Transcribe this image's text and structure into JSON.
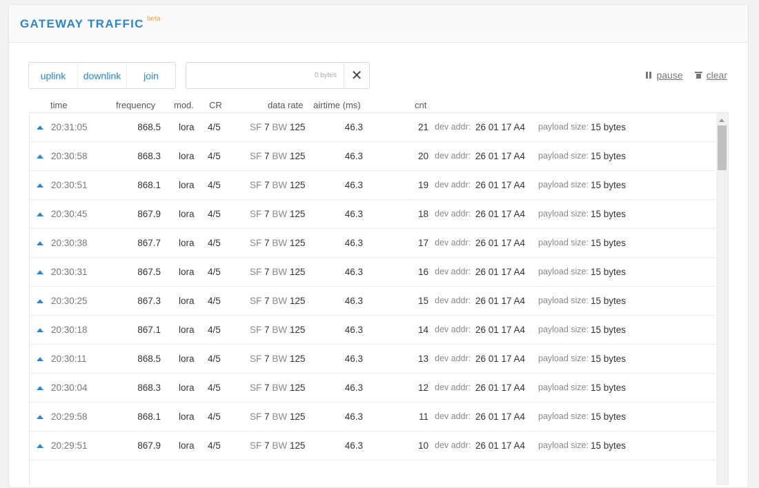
{
  "header": {
    "title": "GATEWAY TRAFFIC",
    "badge": "beta"
  },
  "toolbar": {
    "filters": [
      "uplink",
      "downlink",
      "join"
    ],
    "size_filter": {
      "value": "",
      "placeholder": "",
      "unit": "0 bytes"
    },
    "clear_filter_icon": "close-icon",
    "pause_label": "pause",
    "clear_label": "clear"
  },
  "columns": {
    "time": "time",
    "frequency": "frequency",
    "mod": "mod.",
    "cr": "CR",
    "data_rate": "data rate",
    "airtime": "airtime (ms)",
    "cnt": "cnt"
  },
  "labels": {
    "sf": "SF",
    "bw": "BW",
    "dev_addr": "dev addr:",
    "payload_size": "payload size:"
  },
  "accent_color": "#2a85d0",
  "rows": [
    {
      "time": "20:31:05",
      "frequency": "868.5",
      "mod": "lora",
      "cr": "4/5",
      "sf": "7",
      "bw": "125",
      "airtime": "46.3",
      "cnt": "21",
      "dev_addr": "26 01 17 A4",
      "payload": "15 bytes"
    },
    {
      "time": "20:30:58",
      "frequency": "868.3",
      "mod": "lora",
      "cr": "4/5",
      "sf": "7",
      "bw": "125",
      "airtime": "46.3",
      "cnt": "20",
      "dev_addr": "26 01 17 A4",
      "payload": "15 bytes"
    },
    {
      "time": "20:30:51",
      "frequency": "868.1",
      "mod": "lora",
      "cr": "4/5",
      "sf": "7",
      "bw": "125",
      "airtime": "46.3",
      "cnt": "19",
      "dev_addr": "26 01 17 A4",
      "payload": "15 bytes"
    },
    {
      "time": "20:30:45",
      "frequency": "867.9",
      "mod": "lora",
      "cr": "4/5",
      "sf": "7",
      "bw": "125",
      "airtime": "46.3",
      "cnt": "18",
      "dev_addr": "26 01 17 A4",
      "payload": "15 bytes"
    },
    {
      "time": "20:30:38",
      "frequency": "867.7",
      "mod": "lora",
      "cr": "4/5",
      "sf": "7",
      "bw": "125",
      "airtime": "46.3",
      "cnt": "17",
      "dev_addr": "26 01 17 A4",
      "payload": "15 bytes"
    },
    {
      "time": "20:30:31",
      "frequency": "867.5",
      "mod": "lora",
      "cr": "4/5",
      "sf": "7",
      "bw": "125",
      "airtime": "46.3",
      "cnt": "16",
      "dev_addr": "26 01 17 A4",
      "payload": "15 bytes"
    },
    {
      "time": "20:30:25",
      "frequency": "867.3",
      "mod": "lora",
      "cr": "4/5",
      "sf": "7",
      "bw": "125",
      "airtime": "46.3",
      "cnt": "15",
      "dev_addr": "26 01 17 A4",
      "payload": "15 bytes"
    },
    {
      "time": "20:30:18",
      "frequency": "867.1",
      "mod": "lora",
      "cr": "4/5",
      "sf": "7",
      "bw": "125",
      "airtime": "46.3",
      "cnt": "14",
      "dev_addr": "26 01 17 A4",
      "payload": "15 bytes"
    },
    {
      "time": "20:30:11",
      "frequency": "868.5",
      "mod": "lora",
      "cr": "4/5",
      "sf": "7",
      "bw": "125",
      "airtime": "46.3",
      "cnt": "13",
      "dev_addr": "26 01 17 A4",
      "payload": "15 bytes"
    },
    {
      "time": "20:30:04",
      "frequency": "868.3",
      "mod": "lora",
      "cr": "4/5",
      "sf": "7",
      "bw": "125",
      "airtime": "46.3",
      "cnt": "12",
      "dev_addr": "26 01 17 A4",
      "payload": "15 bytes"
    },
    {
      "time": "20:29:58",
      "frequency": "868.1",
      "mod": "lora",
      "cr": "4/5",
      "sf": "7",
      "bw": "125",
      "airtime": "46.3",
      "cnt": "11",
      "dev_addr": "26 01 17 A4",
      "payload": "15 bytes"
    },
    {
      "time": "20:29:51",
      "frequency": "867.9",
      "mod": "lora",
      "cr": "4/5",
      "sf": "7",
      "bw": "125",
      "airtime": "46.3",
      "cnt": "10",
      "dev_addr": "26 01 17 A4",
      "payload": "15 bytes"
    }
  ]
}
